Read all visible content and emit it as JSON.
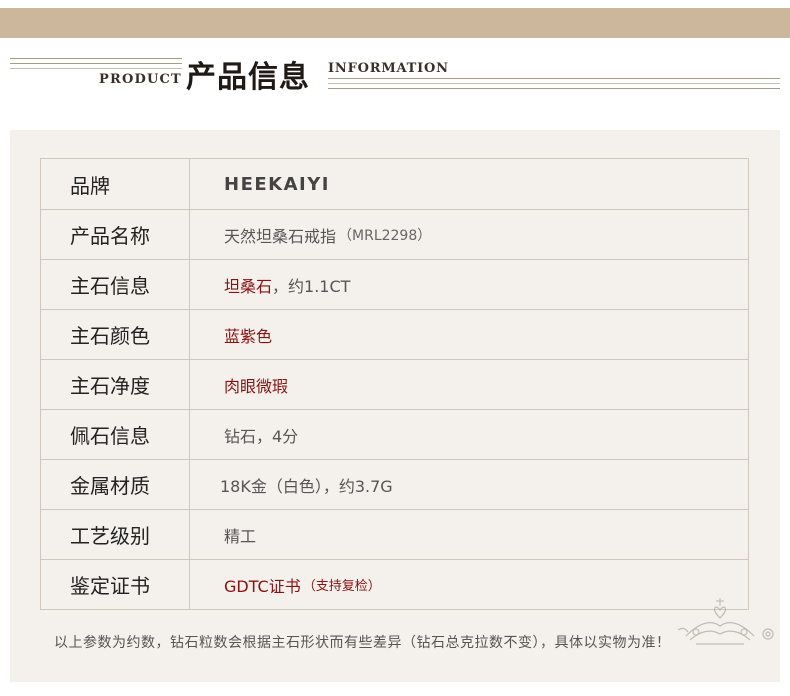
{
  "header": {
    "product_label": "PRODUCT",
    "title": "产品信息",
    "info_label": "INFORMATION"
  },
  "specs": [
    {
      "label": "品牌",
      "value": "HEEKAIYI"
    },
    {
      "label": "产品名称",
      "value": "天然坦桑石戒指",
      "sub": "（MRL2298）"
    },
    {
      "label": "主石信息",
      "value": "坦桑石",
      "value2": "，约1.1CT"
    },
    {
      "label": "主石颜色",
      "value": "蓝紫色"
    },
    {
      "label": "主石净度",
      "value": "肉眼微瑕"
    },
    {
      "label": "佩石信息",
      "value": "钻石，4分"
    },
    {
      "label": "金属材质",
      "value": "18K金（白色），约3.7G"
    },
    {
      "label": "工艺级别",
      "value": "精工"
    },
    {
      "label": "鉴定证书",
      "value": "GDTC证书",
      "sub": "（支持复检）"
    }
  ],
  "footnote": "以上参数为约数，钻石粒数会根据主石形状而有些差异（钻石总克拉数不变），具体以实物为准！",
  "colors": {
    "top_band": "#cdb79c",
    "panel": "#f4f1ec",
    "accent_red": "#8b1010"
  },
  "icons": {
    "crown": "crown-heart-watermark-icon"
  }
}
